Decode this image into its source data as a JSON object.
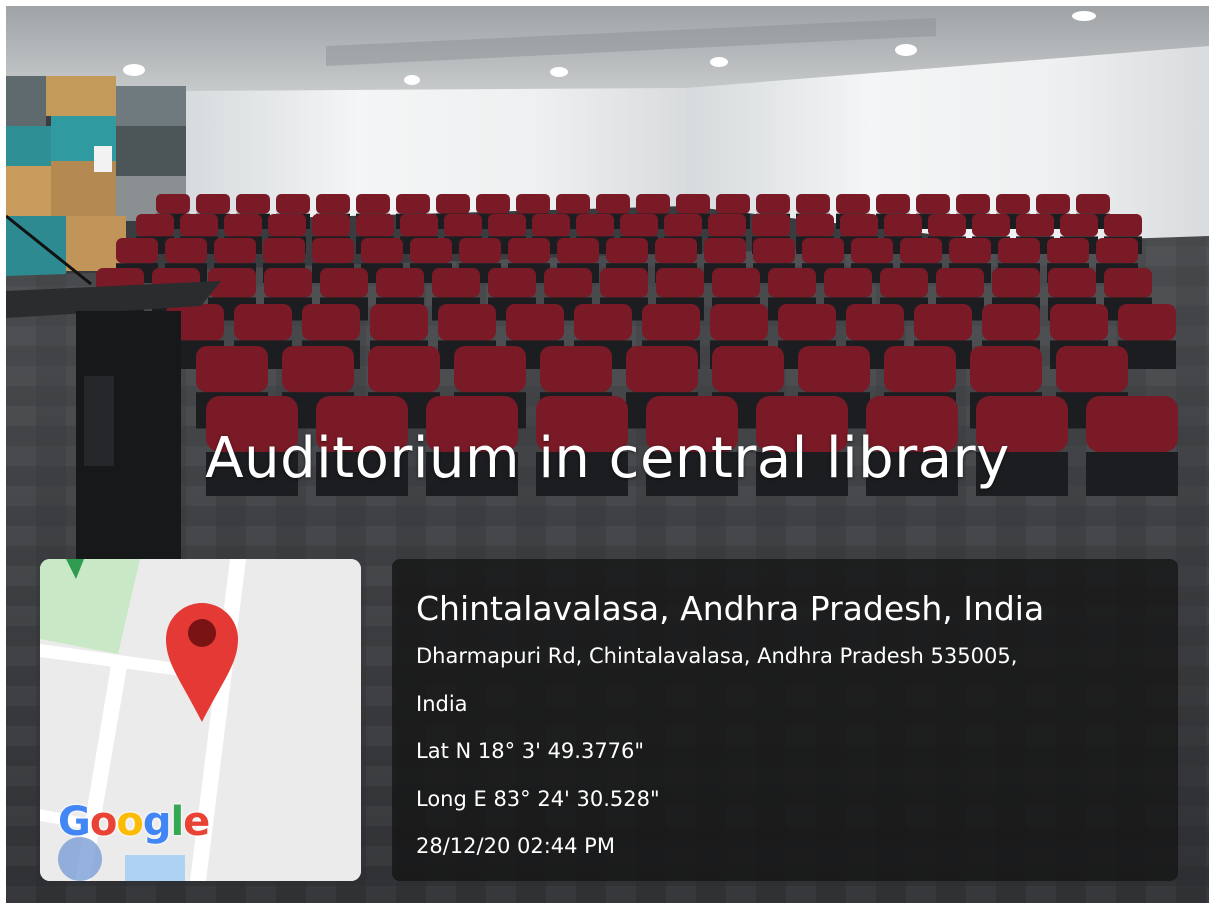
{
  "caption": "Auditorium in central library",
  "location": {
    "place": "Chintalavalasa, Andhra Pradesh, India",
    "address_line1": "Dharmapuri Rd, Chintalavalasa, Andhra Pradesh 535005,",
    "address_line2": "India",
    "latitude": "Lat N 18° 3' 49.3776\"",
    "longitude": "Long E 83° 24' 30.528\"",
    "datetime": "28/12/20 02:44 PM"
  },
  "map": {
    "logo_letters": [
      "G",
      "o",
      "o",
      "g",
      "l",
      "e"
    ],
    "logo_colors": [
      "#4285F4",
      "#EA4335",
      "#FBBC05",
      "#4285F4",
      "#34A853",
      "#EA4335"
    ],
    "pin_icon": "map-pin-icon",
    "pin_color": "#E53935"
  },
  "colors": {
    "seat": "#7a1a26",
    "carpet": "#3b3d40",
    "wall": "#e9ecee",
    "panel": "rgba(20,20,20,0.78)"
  }
}
